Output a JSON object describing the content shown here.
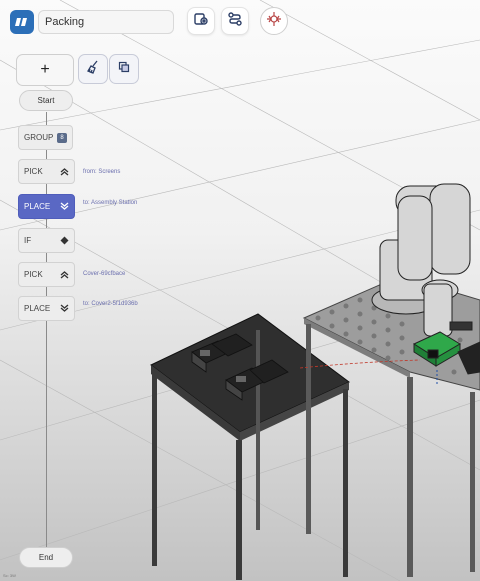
{
  "header": {
    "program_name": "Packing",
    "logo_icon": "brand-logo-icon",
    "tools": [
      {
        "name": "devices-button",
        "icon": "device-settings-icon"
      },
      {
        "name": "path-button",
        "icon": "route-icon"
      },
      {
        "name": "robot-button",
        "icon": "robot-arm-icon"
      }
    ],
    "accent_color": "#2c6fb8"
  },
  "actions": {
    "add_label": "+",
    "clean_icon": "broom-icon",
    "copy_icon": "duplicate-icon"
  },
  "flow": {
    "start_label": "Start",
    "end_label": "End",
    "group": {
      "label": "GROUP",
      "count": "8"
    },
    "steps": [
      {
        "label": "PICK",
        "icon": "chevron-up-double-icon",
        "detail": "from: Screens",
        "active": false
      },
      {
        "label": "PLACE",
        "icon": "chevron-down-double-icon",
        "detail": "to: Assembly Station",
        "active": true
      },
      {
        "label": "IF",
        "icon": "diamond-icon",
        "detail": "",
        "active": false
      },
      {
        "label": "PICK",
        "icon": "chevron-up-double-icon",
        "detail": "Cover-69cfbace",
        "active": false
      },
      {
        "label": "PLACE",
        "icon": "chevron-down-double-icon",
        "detail": "to: Cover2-5f1d936b",
        "active": false
      }
    ],
    "active_color": "#5a68c4"
  },
  "footer": {
    "note": "Sc: 3W"
  }
}
